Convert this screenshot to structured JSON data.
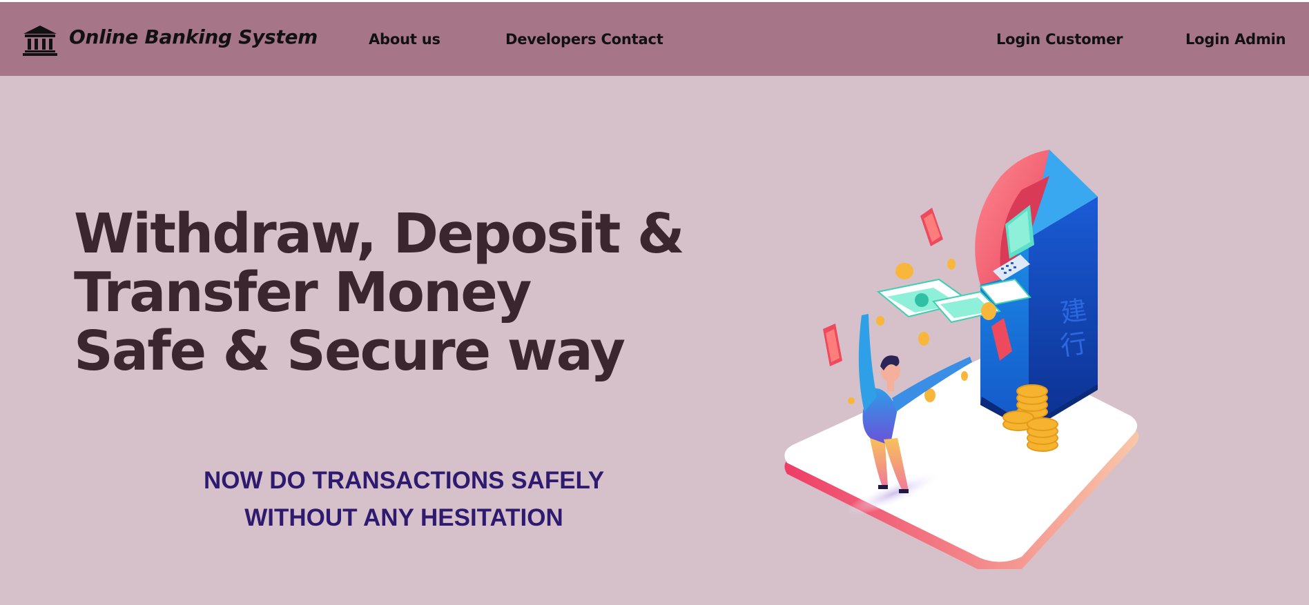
{
  "navbar": {
    "brand_icon": "bank-building-icon",
    "brand_title": "Online Banking System",
    "links": {
      "about": "About us",
      "developers": "Developers Contact",
      "login_customer": "Login Customer",
      "login_admin": "Login Admin"
    }
  },
  "hero": {
    "headline_lines": [
      "Withdraw, Deposit &",
      "Transfer Money",
      "Safe & Secure way"
    ],
    "subline_lines": [
      "NOW DO TRANSACTIONS SAFELY",
      "WITHOUT ANY HESITATION"
    ],
    "illustration": "atm-money-illustration",
    "atm_sign": [
      "建",
      "行"
    ]
  },
  "colors": {
    "navbar_bg": "#a67588",
    "page_bg": "#d6c0ca",
    "headline": "#3b2630",
    "subline": "#2e1a6e"
  }
}
